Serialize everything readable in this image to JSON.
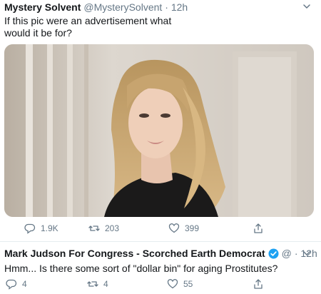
{
  "tweets": [
    {
      "name": "Mystery Solvent",
      "handle": "@MysterySolvent",
      "time": "· 12h",
      "text_line1": "If this pic were an advertisement what",
      "text_line2": "would it be for?",
      "media_alt_icon": "photo-media",
      "replies": "1.9K",
      "retweets": "203",
      "likes": "399"
    },
    {
      "name": "Mark Judson For Congress - Scorched Earth Democrat",
      "handle": "@",
      "time": "· 12h",
      "verified": true,
      "text": "Hmm...  Is there some sort of \"dollar bin\" for aging Prostitutes?",
      "replies": "4",
      "retweets": "4",
      "likes": "55"
    }
  ],
  "colors": {
    "text": "#14171a",
    "secondary": "#657786",
    "verified": "#1da1f2",
    "divider": "#e6ecf0"
  }
}
